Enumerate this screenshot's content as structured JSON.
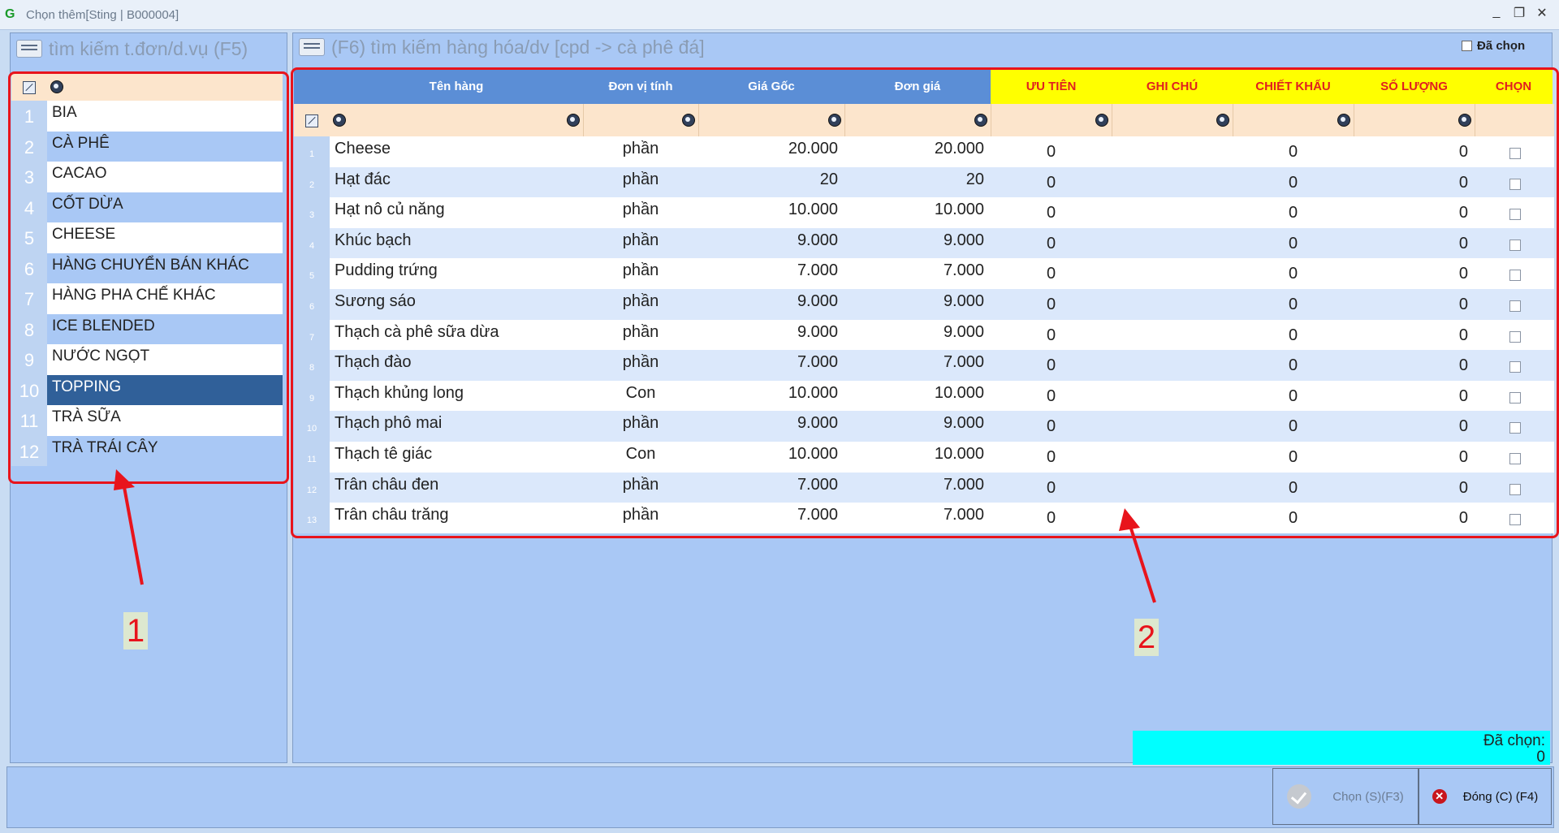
{
  "window": {
    "title": "Chọn thêm[Sting | B000004]"
  },
  "left": {
    "search_title": "tìm kiếm t.đơn/d.vụ (F5)",
    "categories": [
      {
        "num": "1",
        "label": "BIA",
        "style": "w"
      },
      {
        "num": "2",
        "label": "CÀ PHÊ",
        "style": "b"
      },
      {
        "num": "3",
        "label": "CACAO",
        "style": "w"
      },
      {
        "num": "4",
        "label": "CỐT DỪA",
        "style": "b"
      },
      {
        "num": "5",
        "label": "CHEESE",
        "style": "w"
      },
      {
        "num": "6",
        "label": "HÀNG CHUYỂN BÁN KHÁC",
        "style": "b"
      },
      {
        "num": "7",
        "label": "HÀNG PHA CHẾ KHÁC",
        "style": "w"
      },
      {
        "num": "8",
        "label": "ICE BLENDED",
        "style": "b"
      },
      {
        "num": "9",
        "label": "NƯỚC NGỌT",
        "style": "w"
      },
      {
        "num": "10",
        "label": "TOPPING",
        "style": "sel"
      },
      {
        "num": "11",
        "label": "TRÀ SỮA",
        "style": "w"
      },
      {
        "num": "12",
        "label": "TRÀ TRÁI CÂY",
        "style": "b"
      }
    ]
  },
  "right": {
    "search_title": "(F6) tìm kiếm hàng hóa/dv [cpd -> cà phê đá]",
    "da_chon_label": "Đã chọn",
    "columns": {
      "ten_hang": "Tên hàng",
      "don_vi_tinh": "Đơn vị tính",
      "gia_goc": "Giá Gốc",
      "don_gia": "Đơn giá",
      "uu_tien": "ƯU TIÊN",
      "ghi_chu": "GHI CHÚ",
      "chiet_khau": "CHIẾT KHẤU",
      "so_luong": "SỐ LƯỢNG",
      "chon": "CHỌN"
    },
    "rows": [
      {
        "num": "1",
        "name": "Cheese",
        "unit": "phần",
        "gia_goc": "20.000",
        "don_gia": "20.000",
        "uu_tien": "0",
        "chiet_khau": "0",
        "so_luong": "0"
      },
      {
        "num": "2",
        "name": "Hạt đác",
        "unit": "phần",
        "gia_goc": "20",
        "don_gia": "20",
        "uu_tien": "0",
        "chiet_khau": "0",
        "so_luong": "0"
      },
      {
        "num": "3",
        "name": "Hạt nô củ năng",
        "unit": "phần",
        "gia_goc": "10.000",
        "don_gia": "10.000",
        "uu_tien": "0",
        "chiet_khau": "0",
        "so_luong": "0"
      },
      {
        "num": "4",
        "name": "Khúc bạch",
        "unit": "phần",
        "gia_goc": "9.000",
        "don_gia": "9.000",
        "uu_tien": "0",
        "chiet_khau": "0",
        "so_luong": "0"
      },
      {
        "num": "5",
        "name": "Pudding trứng",
        "unit": "phần",
        "gia_goc": "7.000",
        "don_gia": "7.000",
        "uu_tien": "0",
        "chiet_khau": "0",
        "so_luong": "0"
      },
      {
        "num": "6",
        "name": "Sương sáo",
        "unit": "phần",
        "gia_goc": "9.000",
        "don_gia": "9.000",
        "uu_tien": "0",
        "chiet_khau": "0",
        "so_luong": "0"
      },
      {
        "num": "7",
        "name": "Thạch cà phê sữa dừa",
        "unit": "phần",
        "gia_goc": "9.000",
        "don_gia": "9.000",
        "uu_tien": "0",
        "chiet_khau": "0",
        "so_luong": "0"
      },
      {
        "num": "8",
        "name": "Thạch đào",
        "unit": "phần",
        "gia_goc": "7.000",
        "don_gia": "7.000",
        "uu_tien": "0",
        "chiet_khau": "0",
        "so_luong": "0"
      },
      {
        "num": "9",
        "name": "Thạch khủng long",
        "unit": "Con",
        "gia_goc": "10.000",
        "don_gia": "10.000",
        "uu_tien": "0",
        "chiet_khau": "0",
        "so_luong": "0"
      },
      {
        "num": "10",
        "name": "Thạch phô mai",
        "unit": "phần",
        "gia_goc": "9.000",
        "don_gia": "9.000",
        "uu_tien": "0",
        "chiet_khau": "0",
        "so_luong": "0"
      },
      {
        "num": "11",
        "name": "Thạch tê giác",
        "unit": "Con",
        "gia_goc": "10.000",
        "don_gia": "10.000",
        "uu_tien": "0",
        "chiet_khau": "0",
        "so_luong": "0"
      },
      {
        "num": "12",
        "name": "Trân châu đen",
        "unit": "phần",
        "gia_goc": "7.000",
        "don_gia": "7.000",
        "uu_tien": "0",
        "chiet_khau": "0",
        "so_luong": "0"
      },
      {
        "num": "13",
        "name": "Trân châu trăng",
        "unit": "phần",
        "gia_goc": "7.000",
        "don_gia": "7.000",
        "uu_tien": "0",
        "chiet_khau": "0",
        "so_luong": "0"
      }
    ],
    "summary": {
      "label": "Đã chọn:",
      "count": "0"
    }
  },
  "buttons": {
    "chon": "Chọn (S)(F3)",
    "dong": "Đóng (C) (F4)"
  },
  "annotations": {
    "label1": "1",
    "label2": "2"
  },
  "colors": {
    "header_blue": "#5b8ed6",
    "header_yellow": "#ffff00",
    "header_red_text": "#e02020",
    "selected_row": "#306099",
    "annotation_red": "#e8141c",
    "summary_cyan": "#00ffff"
  }
}
